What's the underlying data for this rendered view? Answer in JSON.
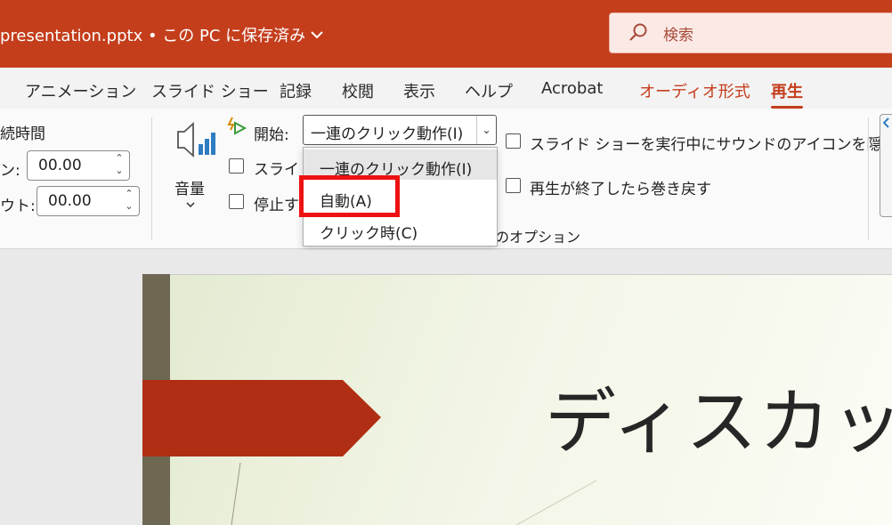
{
  "title_bar": {
    "document_title": "presentation.pptx • この PC に保存済み",
    "search_placeholder": "検索",
    "accent_color": "#c43e1c"
  },
  "ribbon_tabs": [
    {
      "label": "アニメーション"
    },
    {
      "label": "スライド ショー"
    },
    {
      "label": "記録"
    },
    {
      "label": "校閲"
    },
    {
      "label": "表示"
    },
    {
      "label": "ヘルプ"
    },
    {
      "label": "Acrobat"
    },
    {
      "label": "オーディオ形式"
    },
    {
      "label": "再生",
      "active": true
    }
  ],
  "fade": {
    "group_label_partial": "続時間",
    "fade_in_label_partial": "ン:",
    "fade_in_value": "00.00",
    "fade_out_label_partial": "ウト:",
    "fade_out_value": "00.00"
  },
  "volume": {
    "label": "音量"
  },
  "audio_options": {
    "start_label": "開始:",
    "start_value": "一連のクリック動作(I)",
    "start_options": [
      "一連のクリック動作(I)",
      "自動(A)",
      "クリック時(C)"
    ],
    "highlighted_option": "自動(A)",
    "checkbox_play_across_partial": "スライド",
    "checkbox_loop_partial": "停止す",
    "checkbox_hide_icon": "スライド ショーを実行中にサウンドのアイコンを隠す",
    "checkbox_rewind": "再生が終了したら巻き戻す",
    "group_label_partial": "のオプション"
  },
  "slide": {
    "title_partial": "ディスカッ"
  }
}
